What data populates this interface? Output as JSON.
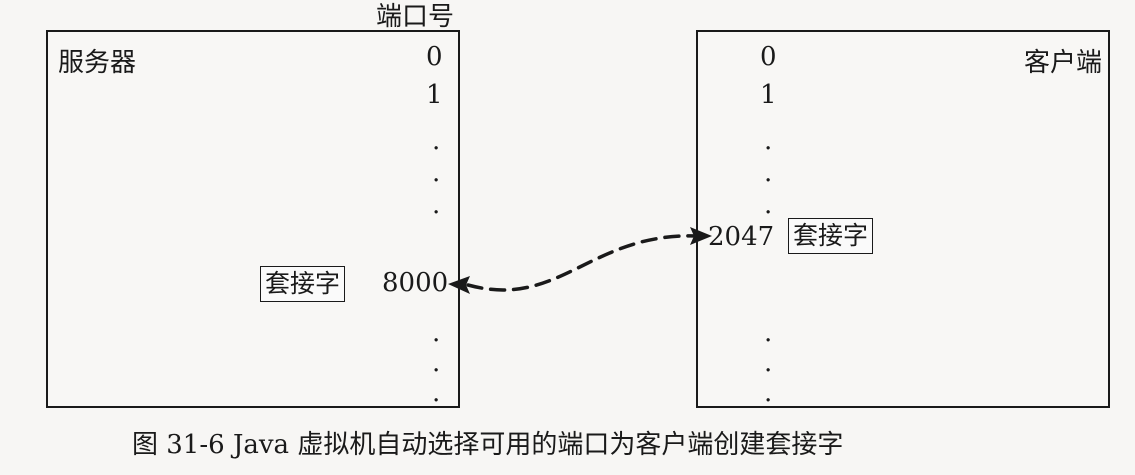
{
  "header_label": "端口号",
  "server": {
    "title": "服务器",
    "port_0": "0",
    "port_1": "1",
    "dot": ".",
    "socket": "套接字",
    "socket_port": "8000"
  },
  "client": {
    "title": "客户端",
    "port_0": "0",
    "port_1": "1",
    "dot": ".",
    "socket": "套接字",
    "socket_port": "2047"
  },
  "caption": "图 31-6   Java 虚拟机自动选择可用的端口为客户端创建套接字"
}
